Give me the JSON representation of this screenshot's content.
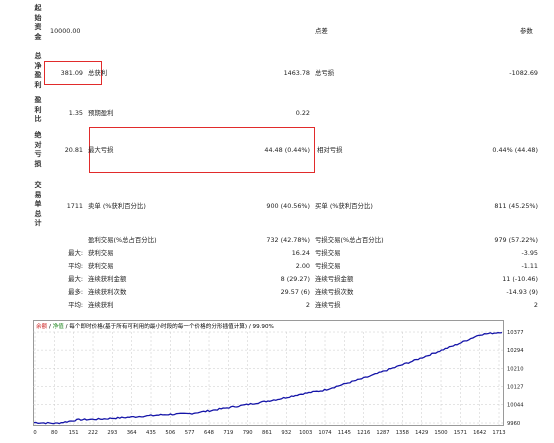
{
  "left_labels": [
    "起始资金",
    "总净盈利",
    "盈利比",
    "绝对亏损",
    "交易单总计"
  ],
  "initial_deposit": "10000.00",
  "header": {
    "col_mid": "点差",
    "col_right": "参数"
  },
  "rows": {
    "profit": {
      "value": "381.09",
      "label": "总获利",
      "mid": "1463.78",
      "label2": "总亏损",
      "right": "-1082.69"
    },
    "expected": {
      "value": "1.35",
      "label": "预期盈利",
      "mid": "0.22"
    },
    "drawdown": {
      "value": "20.81",
      "label": "最大亏损",
      "mid": "44.48 (0.44%)",
      "label2": "相对亏损",
      "right": "0.44% (44.48)"
    },
    "trades": {
      "value": "1711",
      "label": "卖单 (%获利百分比)",
      "mid": "900 (40.56%)",
      "label2": "买单 (%获利百分比)",
      "right": "811 (45.25%)"
    }
  },
  "stats": [
    {
      "p": "",
      "l": "盈利交易(%总占百分比)",
      "m": "732 (42.78%)",
      "l2": "亏损交易(%总占百分比)",
      "r": "979 (57.22%)"
    },
    {
      "p": "最大:",
      "l": "获利交易",
      "m": "16.24",
      "l2": "亏损交易",
      "r": "-3.95"
    },
    {
      "p": "平均:",
      "l": "获利交易",
      "m": "2.00",
      "l2": "亏损交易",
      "r": "-1.11"
    },
    {
      "p": "最大:",
      "l": "连续获利金额",
      "m": "8 (29.27)",
      "l2": "连续亏损金额",
      "r": "11 (-10.46)"
    },
    {
      "p": "最多:",
      "l": "连续获利次数",
      "m": "29.57 (6)",
      "l2": "连续亏损次数",
      "r": "-14.93 (9)"
    },
    {
      "p": "平均:",
      "l": "连续获利",
      "m": "2",
      "l2": "连续亏损",
      "r": "2"
    }
  ],
  "chart_caption": {
    "a": "余额",
    "sep1": " / ",
    "b": "净值",
    "rest": " / 每个即时价格(基于所有可利用的最小时段的每一个价格的分形插值计算) / 99.90%"
  },
  "chart_data": {
    "type": "line",
    "series": [
      {
        "values": [
          9962,
          9958,
          9975,
          9978,
          9985,
          9992,
          9999,
          10003,
          10018,
          10035,
          10052,
          10070,
          10093,
          10110,
          10141,
          10172,
          10208,
          10244,
          10282,
          10321,
          10365,
          10377
        ]
      }
    ],
    "x_ticks": [
      "0",
      "80",
      "151",
      "222",
      "293",
      "364",
      "435",
      "506",
      "577",
      "648",
      "719",
      "790",
      "861",
      "932",
      "1003",
      "1074",
      "1145",
      "1216",
      "1287",
      "1358",
      "1429",
      "1500",
      "1571",
      "1642",
      "1713"
    ],
    "y_ticks": [
      "10377",
      "10294",
      "10210",
      "10127",
      "10044",
      "9960"
    ],
    "ylim": [
      9960,
      10377
    ],
    "xlim": [
      0,
      1713
    ]
  },
  "colors": {
    "line": "#1515a8",
    "highlight": "#e12b2b",
    "grid": "#c8c8c8",
    "caption_a": "#cc2222",
    "caption_b": "#228822"
  }
}
